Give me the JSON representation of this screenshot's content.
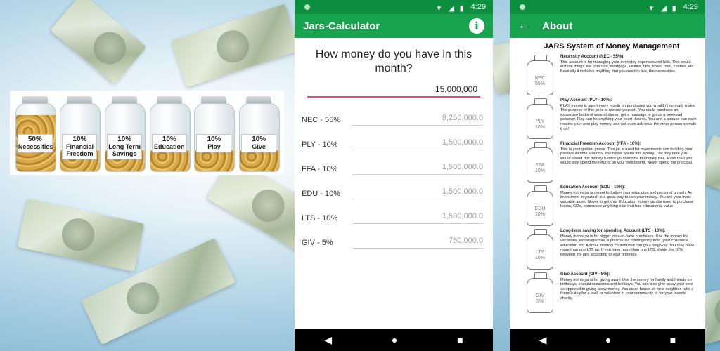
{
  "status": {
    "time": "4:29"
  },
  "banner": {
    "jars": [
      {
        "pct": "50%",
        "name": "Necessities"
      },
      {
        "pct": "10%",
        "name": "Financial Freedom"
      },
      {
        "pct": "10%",
        "name": "Long Term Savings"
      },
      {
        "pct": "10%",
        "name": "Education"
      },
      {
        "pct": "10%",
        "name": "Play"
      },
      {
        "pct": "10%",
        "name": "Give"
      }
    ]
  },
  "calc": {
    "title": "Jars-Calculator",
    "question": "How money do you have in this month?",
    "amount": "15,000,000",
    "rows": [
      {
        "label": "NEC - 55%",
        "value": "8,250,000.0"
      },
      {
        "label": "PLY - 10%",
        "value": "1,500,000.0"
      },
      {
        "label": "FFA - 10%",
        "value": "1,500,000.0"
      },
      {
        "label": "EDU - 10%",
        "value": "1,500,000.0"
      },
      {
        "label": "LTS - 10%",
        "value": "1,500,000.0"
      },
      {
        "label": "GIV - 5%",
        "value": "750,000.0"
      }
    ]
  },
  "about": {
    "title": "About",
    "heading": "JARS System of Money Management",
    "entries": [
      {
        "jar_code": "NEC",
        "jar_pct": "55%",
        "title": "Necessity Account (NEC - 55%):",
        "text": "This account is for managing your everyday expenses and bills. This would include things like your rent, mortgage, utilities, bills, taxes, food, clothes, etc. Basically it includes anything that you need to live, the necessities."
      },
      {
        "jar_code": "PLY",
        "jar_pct": "10%",
        "title": "Play Account (PLY - 10%):",
        "text": "PLAY money is spent every month on purchases you wouldn't normally make. The purpose of this jar is to nurture yourself. You could purchase an expensive bottle of wine at dinner, get a massage or go on a weekend getaway. Play can be anything your heart desires. You and a spouse can each receive your own play money, and not even ask what the other person spends it on!"
      },
      {
        "jar_code": "FFA",
        "jar_pct": "10%",
        "title": "Financial Freedom Account (FFA - 10%):",
        "text": "This is your golden goose. This jar is used for investments and building your passive income streams. You never spend this money. The only time you would spend this money is once you become financially free. Even then you would only spend the returns on your investment. Never spend the principal."
      },
      {
        "jar_code": "EDU",
        "jar_pct": "10%",
        "title": "Education Account (EDU - 10%):",
        "text": "Money in this jar is meant to further your education and personal growth. An investment in yourself is a great way to use your money. You are your most valuable asset. Never forget this. Education money can be used to purchase books, CD's, courses or anything else that has educational value."
      },
      {
        "jar_code": "LTS",
        "jar_pct": "10%",
        "title": "Long-term saving for spending Account (LTS - 10%):",
        "text": "Money in this jar is for bigger, nice-to-have purchases. Use the money for vacations, extravagances, a plasma TV, contingency fund, your children's education etc. A small monthly contribution can go a long way. You may have more than one LTS jar. If you have more than one LTS, divide the 10% between the jars according to your priorities."
      },
      {
        "jar_code": "GIV",
        "jar_pct": "5%",
        "title": "Give Account (GIV - 5%):",
        "text": "Money in this jar is for giving away. Use the money for family and friends on birthdays, special occasions and holidays. You can also give away your time as opposed to giving away money. You could house sit for a neighbor, take a friend's dog for a walk or volunteer in your community or for your favorite charity."
      }
    ]
  },
  "colors": {
    "primary": "#18a34e",
    "primary_dark": "#0b8f3f",
    "accent": "#e24a6b"
  },
  "icons": {
    "info": "info-icon",
    "back": "arrow-back-icon",
    "nav_back": "nav-back-icon",
    "nav_home": "nav-home-icon",
    "nav_recent": "nav-recent-icon"
  }
}
